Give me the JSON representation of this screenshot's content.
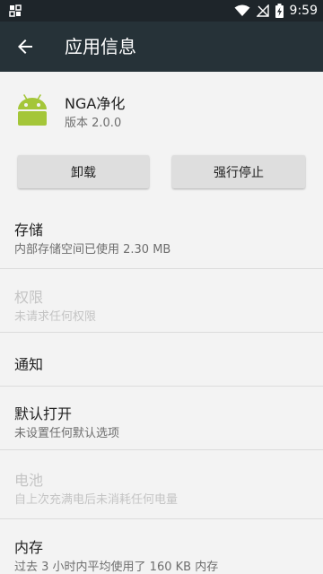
{
  "status_bar": {
    "time": "9:59",
    "battery_icon": "battery-charging-icon",
    "wifi_icon": "wifi-icon",
    "signal_icon": "signal-off-icon"
  },
  "app_bar": {
    "title": "应用信息",
    "back_icon": "arrow-back-icon"
  },
  "app": {
    "name": "NGA净化",
    "version": "版本 2.0.0",
    "icon": "android-robot-icon",
    "icon_color": "#a4c639"
  },
  "buttons": {
    "uninstall": "卸载",
    "force_stop": "强行停止"
  },
  "sections": [
    {
      "title": "存储",
      "subtitle": "内部存储空间已使用 2.30 MB",
      "enabled": true
    },
    {
      "title": "权限",
      "subtitle": "未请求任何权限",
      "enabled": false
    },
    {
      "title": "通知",
      "subtitle": "",
      "enabled": true
    },
    {
      "title": "默认打开",
      "subtitle": "未设置任何默认选项",
      "enabled": true
    },
    {
      "title": "电池",
      "subtitle": "自上次充满电后未消耗任何电量",
      "enabled": false
    },
    {
      "title": "内存",
      "subtitle": "过去 3 小时内平均使用了 160 KB 内存",
      "enabled": true
    }
  ],
  "colors": {
    "app_bar": "#263238",
    "status_bar": "#1e252a",
    "background": "#f3f3f3",
    "disabled_text": "#c4c4c4"
  }
}
